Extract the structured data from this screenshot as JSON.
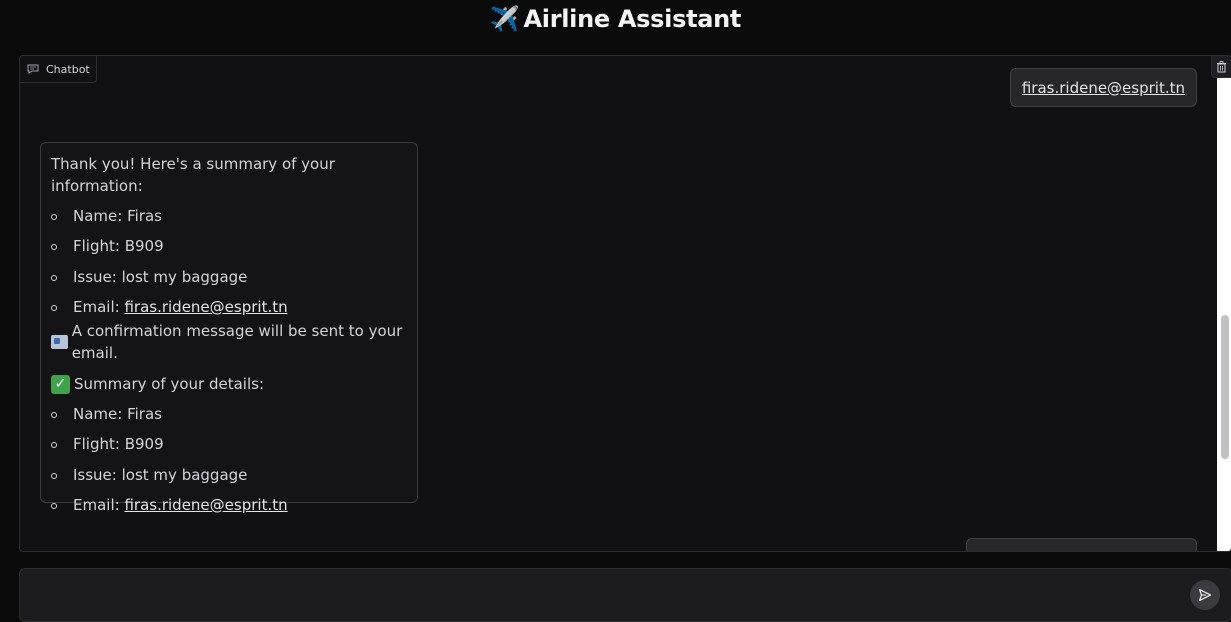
{
  "header": {
    "title_icon": "✈️",
    "title": "Airline Assistant"
  },
  "chatbot": {
    "label": "Chatbot",
    "label_icon": "chat-icon",
    "clear_icon": "trash-icon",
    "messages": [
      {
        "role": "user",
        "text": "firas.ridene@esprit.tn"
      },
      {
        "role": "assistant",
        "intro": "Thank you! Here's a summary of your information:",
        "list1": [
          {
            "label": "Name: ",
            "value": "Firas"
          },
          {
            "label": "Flight: ",
            "value": "B909"
          },
          {
            "label": "Issue: ",
            "value": "lost my baggage"
          },
          {
            "label": "Email: ",
            "value": "firas.ridene@esprit.tn"
          }
        ],
        "notice_icon": "envelope-icon",
        "notice": "A confirmation message will be sent to your email.",
        "summary_icon": "check-mark-icon",
        "summary_heading": "Summary of your details:",
        "list2": [
          {
            "label": "Name: ",
            "value": "Firas"
          },
          {
            "label": "Flight: ",
            "value": "B909"
          },
          {
            "label": "Issue: ",
            "value": "lost my baggage"
          },
          {
            "label": "Email: ",
            "value": "firas.ridene@esprit.tn"
          }
        ]
      }
    ]
  },
  "input": {
    "value": "",
    "placeholder": "",
    "send_icon": "send-icon"
  },
  "colors": {
    "background": "#0b0b0c",
    "panel": "#111114",
    "bubble_user": "#27272a",
    "text": "#e4e4e7"
  }
}
